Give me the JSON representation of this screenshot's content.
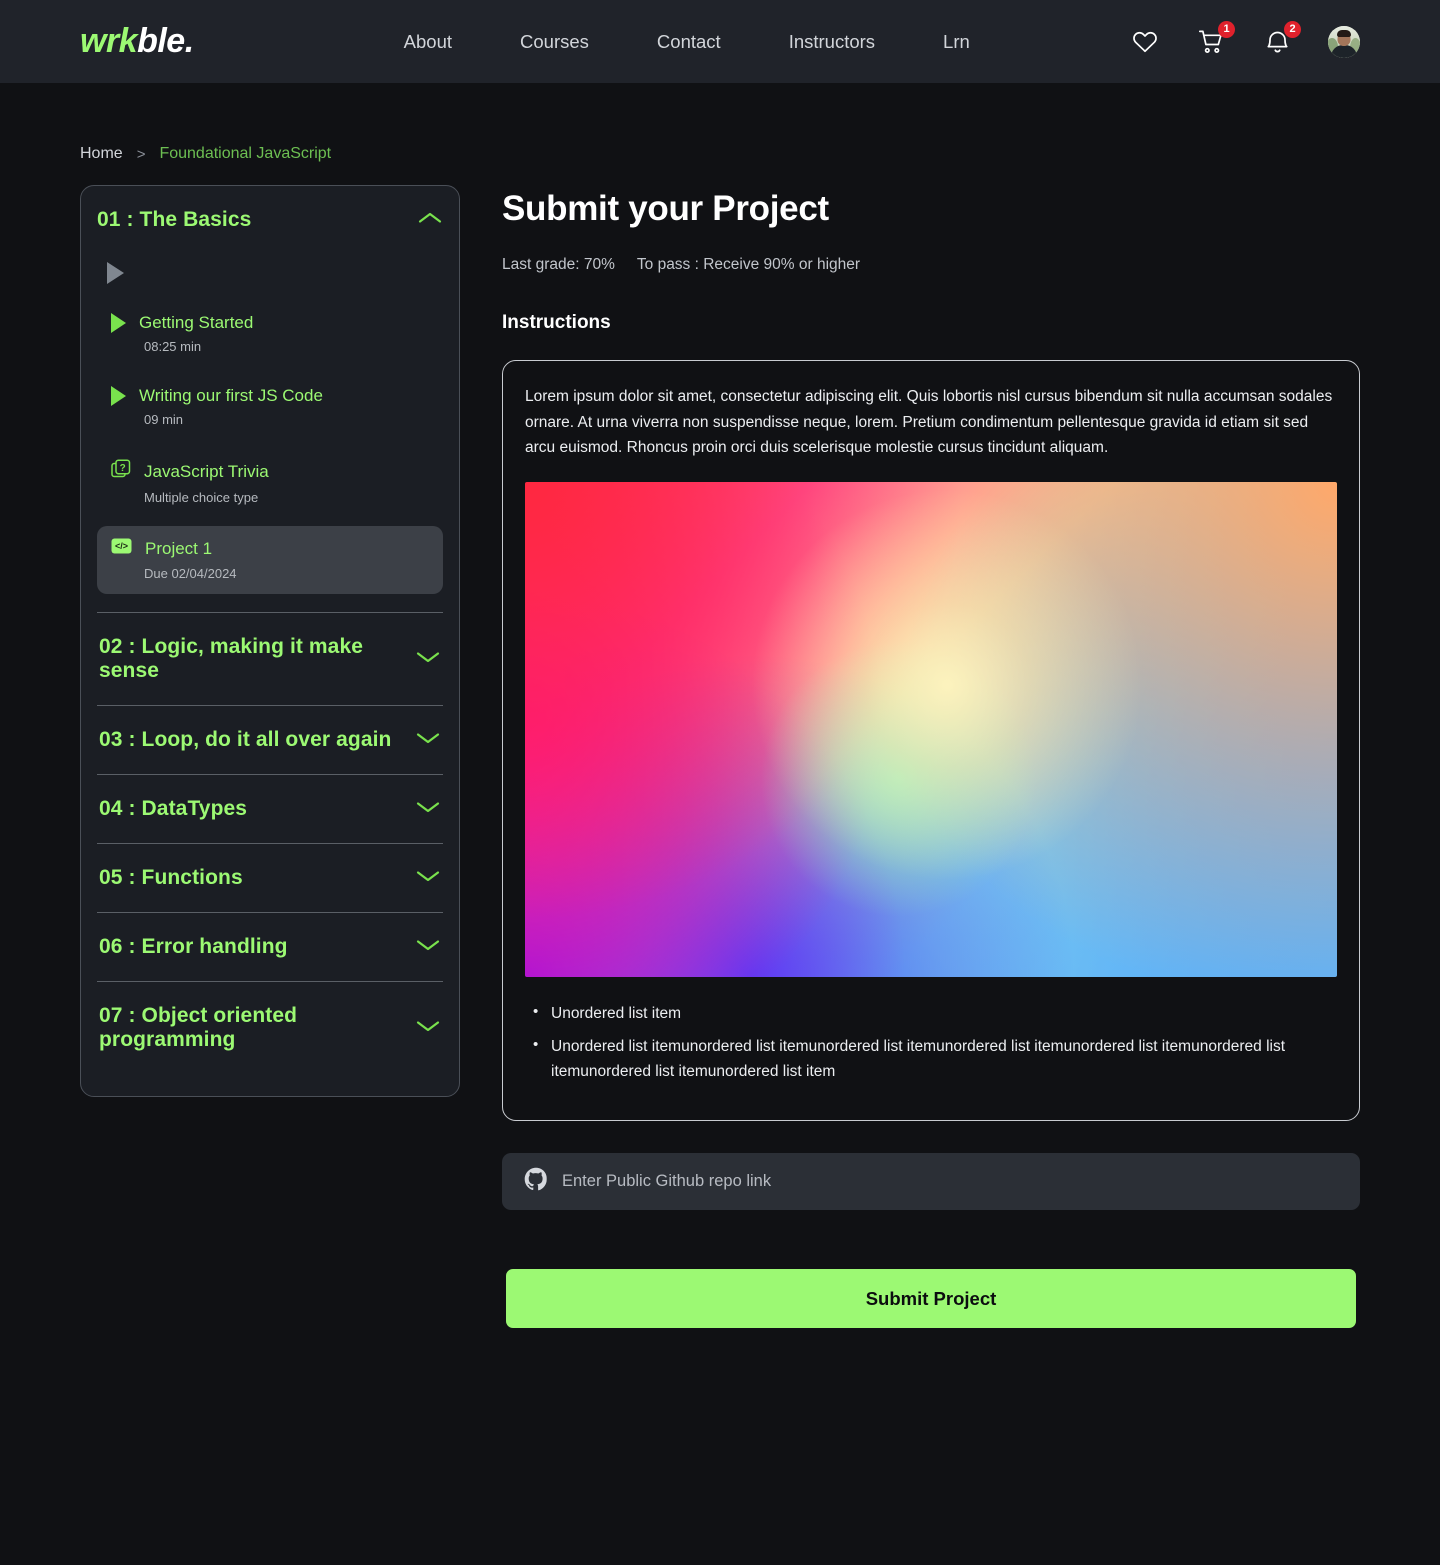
{
  "brand": {
    "part_green": "wrk",
    "part_white": "ble.",
    "accent": "#9cf973"
  },
  "header": {
    "nav": [
      {
        "label": "About"
      },
      {
        "label": "Courses"
      },
      {
        "label": "Contact"
      },
      {
        "label": "Instructors"
      },
      {
        "label": "Lrn"
      }
    ],
    "icons": {
      "wishlist": "heart-icon",
      "cart": "cart-icon",
      "cart_badge": "1",
      "notifications": "bell-icon",
      "notifications_badge": "2",
      "avatar": "user-avatar"
    }
  },
  "breadcrumb": {
    "home": "Home",
    "separator": ">",
    "current": "Foundational JavaScript"
  },
  "sidebar": {
    "active_module": {
      "title": "01 : The Basics",
      "chevron": "chevron-up-icon",
      "lessons": [
        {
          "icon": "play-icon",
          "title": "Getting Started",
          "sub": "08:25 min",
          "active": false
        },
        {
          "icon": "play-icon",
          "title": "Writing our first JS Code",
          "sub": "09 min",
          "active": false
        },
        {
          "icon": "quiz-icon",
          "title": "JavaScript Trivia",
          "sub": "Multiple choice type",
          "active": false
        },
        {
          "icon": "code-icon",
          "title": "Project 1",
          "sub": "Due 02/04/2024",
          "active": true
        }
      ]
    },
    "modules": [
      {
        "title": "02 : Logic, making it make sense",
        "chevron": "chevron-down-icon"
      },
      {
        "title": "03 : Loop, do it all over again",
        "chevron": "chevron-down-icon"
      },
      {
        "title": "04 : DataTypes",
        "chevron": "chevron-down-icon"
      },
      {
        "title": "05 : Functions",
        "chevron": "chevron-down-icon"
      },
      {
        "title": "06 : Error handling",
        "chevron": "chevron-down-icon"
      },
      {
        "title": "07 : Object oriented programming",
        "chevron": "chevron-down-icon"
      }
    ]
  },
  "main": {
    "title": "Submit your Project",
    "last_grade": "Last grade: 70%",
    "to_pass": "To pass : Receive 90% or higher",
    "instructions_heading": "Instructions",
    "instructions_body": "Lorem ipsum dolor sit amet, consectetur adipiscing elit. Quis lobortis nisl cursus bibendum sit nulla accumsan sodales ornare. At urna viverra non suspendisse neque, lorem. Pretium condimentum pellentesque gravida id etiam sit sed arcu euismod. Rhoncus proin orci duis scelerisque molestie cursus tincidunt aliquam.",
    "image_alt": "gradient-mesh-image",
    "bullets": [
      "Unordered list item",
      "Unordered list itemunordered list itemunordered list itemunordered list itemunordered list itemunordered list itemunordered list itemunordered list item"
    ],
    "repo_input": {
      "icon": "github-icon",
      "placeholder": "Enter Public Github repo link",
      "value": ""
    },
    "submit_label": "Submit Project"
  }
}
